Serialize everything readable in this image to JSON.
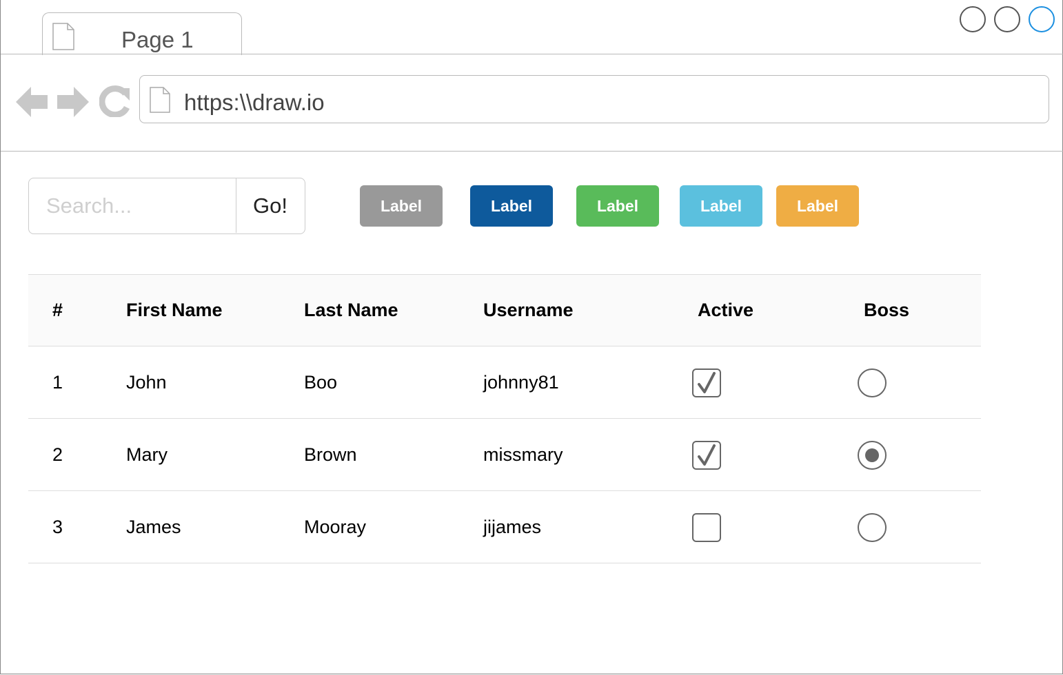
{
  "browser": {
    "tab": {
      "label": "Page 1",
      "icon": "file-icon"
    },
    "window_controls": [
      {
        "name": "window-button-1",
        "color": "#555555"
      },
      {
        "name": "window-button-2",
        "color": "#555555"
      },
      {
        "name": "window-button-3",
        "color": "#1b8fe0"
      }
    ],
    "nav": {
      "back_icon": "arrow-left-icon",
      "forward_icon": "arrow-right-icon",
      "reload_icon": "reload-icon",
      "nav_icon_color": "#c8c8c8"
    },
    "url": {
      "value": "https:\\\\draw.io",
      "icon": "file-icon"
    }
  },
  "search": {
    "placeholder": "Search...",
    "value": "",
    "button_label": "Go!"
  },
  "badges": [
    {
      "label": "Label",
      "color": "#999999"
    },
    {
      "label": "Label",
      "color": "#0e5a9c"
    },
    {
      "label": "Label",
      "color": "#59bb5a"
    },
    {
      "label": "Label",
      "color": "#5bc0de"
    },
    {
      "label": "Label",
      "color": "#efad44"
    }
  ],
  "table": {
    "headers": [
      "#",
      "First Name",
      "Last Name",
      "Username",
      "Active",
      "Boss"
    ],
    "rows": [
      {
        "num": "1",
        "first": "John",
        "last": "Boo",
        "username": "johnny81",
        "active": true,
        "boss": false
      },
      {
        "num": "2",
        "first": "Mary",
        "last": "Brown",
        "username": "missmary",
        "active": true,
        "boss": true
      },
      {
        "num": "3",
        "first": "James",
        "last": "Mooray",
        "username": "jijames",
        "active": false,
        "boss": false
      }
    ]
  }
}
